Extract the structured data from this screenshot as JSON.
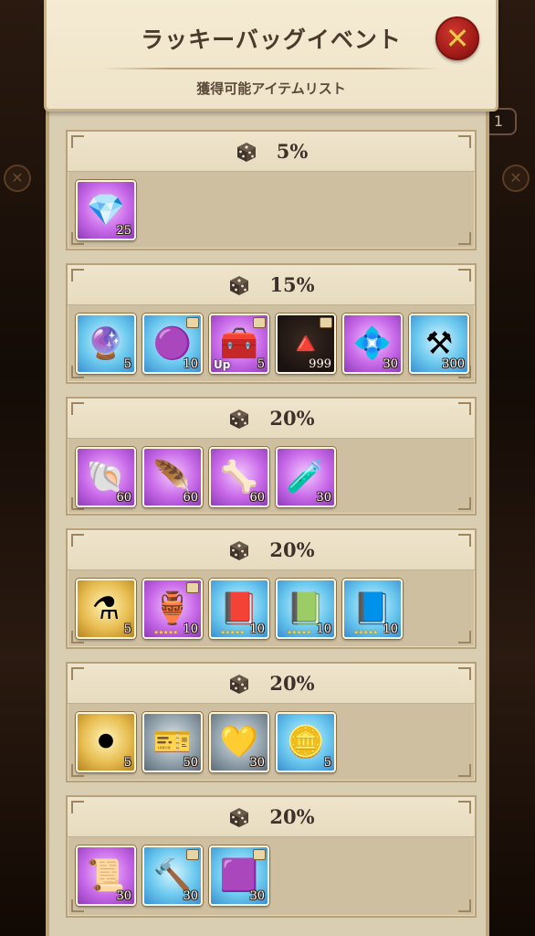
{
  "window": {
    "title": "ラッキーバッグイベント",
    "subtitle": "獲得可能アイテムリスト",
    "close_label": "✕"
  },
  "background": {
    "badge_text": "1"
  },
  "colors": {
    "parchment": "#efe4c9",
    "close_button": "#b3221d",
    "percent_text": "#3d3129"
  },
  "tiers": [
    {
      "percent": "5%",
      "items": [
        {
          "icon": "blue-diamond-icon",
          "glyph": "💎",
          "frame": "purple",
          "qty": "25"
        }
      ]
    },
    {
      "percent": "15%",
      "items": [
        {
          "icon": "magic-orb-icon",
          "glyph": "🔮",
          "frame": "blue",
          "qty": "5"
        },
        {
          "icon": "purple-gem-icon",
          "glyph": "🟣",
          "frame": "blue",
          "qty": "10",
          "tag": true
        },
        {
          "icon": "treasure-chest-icon",
          "glyph": "🧰",
          "frame": "purple",
          "qty": "5",
          "tag": true,
          "up": "Up"
        },
        {
          "icon": "red-crystal-icon",
          "glyph": "🔺",
          "frame": "dark",
          "qty": "999",
          "tag": true
        },
        {
          "icon": "crystal-shard-icon",
          "glyph": "💠",
          "frame": "purple",
          "qty": "30"
        },
        {
          "icon": "anvil-icon",
          "glyph": "⚒",
          "frame": "blue",
          "qty": "300"
        }
      ]
    },
    {
      "percent": "20%",
      "items": [
        {
          "icon": "horn-icon",
          "glyph": "🐚",
          "frame": "purple",
          "qty": "60"
        },
        {
          "icon": "wing-icon",
          "glyph": "🪶",
          "frame": "purple",
          "qty": "60"
        },
        {
          "icon": "claw-icon",
          "glyph": "🦴",
          "frame": "purple",
          "qty": "60"
        },
        {
          "icon": "potion-bottle-icon",
          "glyph": "🧪",
          "frame": "purple",
          "qty": "30"
        }
      ]
    },
    {
      "percent": "20%",
      "items": [
        {
          "icon": "orange-potion-icon",
          "glyph": "⚗",
          "frame": "gold",
          "qty": "5"
        },
        {
          "icon": "golden-idol-icon",
          "glyph": "🏺",
          "frame": "purple",
          "qty": "10",
          "tag": true,
          "stars": "★★★★★"
        },
        {
          "icon": "red-tome-icon",
          "glyph": "📕",
          "frame": "blue",
          "qty": "10",
          "stars": "★★★★★"
        },
        {
          "icon": "green-tome-icon",
          "glyph": "📗",
          "frame": "blue",
          "qty": "10",
          "stars": "★★★★★"
        },
        {
          "icon": "blue-tome-icon",
          "glyph": "📘",
          "frame": "blue",
          "qty": "10",
          "stars": "★★★★★"
        }
      ]
    },
    {
      "percent": "20%",
      "items": [
        {
          "icon": "dark-orbs-icon",
          "glyph": "⚫",
          "frame": "gold",
          "qty": "5"
        },
        {
          "icon": "ticket-icon",
          "glyph": "🎫",
          "frame": "grey",
          "qty": "50"
        },
        {
          "icon": "golden-heart-icon",
          "glyph": "💛",
          "frame": "grey",
          "qty": "30"
        },
        {
          "icon": "gold-coins-icon",
          "glyph": "🪙",
          "frame": "blue",
          "qty": "5"
        }
      ]
    },
    {
      "percent": "20%",
      "items": [
        {
          "icon": "scroll-icon",
          "glyph": "📜",
          "frame": "purple",
          "qty": "30"
        },
        {
          "icon": "hammer-icon",
          "glyph": "🔨",
          "frame": "blue",
          "qty": "30",
          "tag": true
        },
        {
          "icon": "amethyst-icon",
          "glyph": "🟪",
          "frame": "blue",
          "qty": "30",
          "tag": true
        }
      ]
    }
  ]
}
